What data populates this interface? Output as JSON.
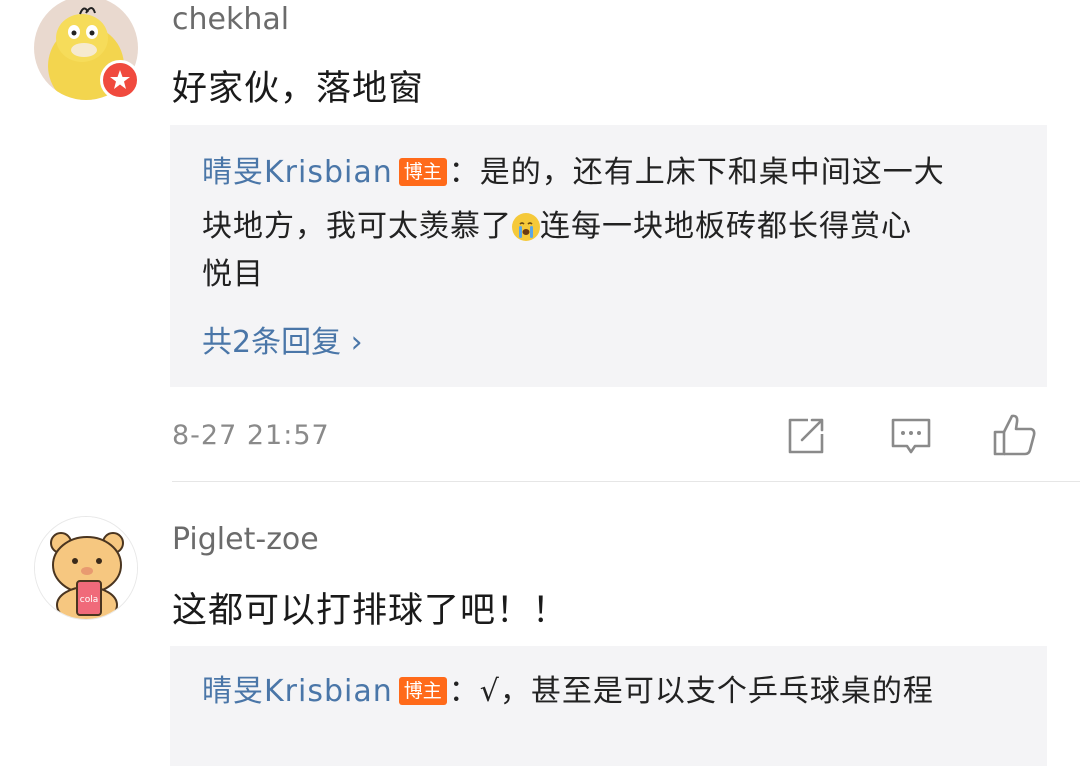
{
  "comments": [
    {
      "username": "chekhal",
      "text": "好家伙，落地窗",
      "reply": {
        "replier": "晴旻Krisbian",
        "badge": "博主",
        "line1": "：是的，还有上床下和桌中间这一大",
        "line2a": "块地方，我可太羡慕了",
        "line2b": "连每一块地板砖都长得赏心",
        "line3": "悦目"
      },
      "total_replies": "共2条回复 ›",
      "timestamp": "8-27 21:57"
    },
    {
      "username": "Piglet-zoe",
      "text": "这都可以打排球了吧！！",
      "reply": {
        "replier": "晴旻Krisbian",
        "badge": "博主",
        "line1": "：√，甚至是可以支个乒乓球桌的程"
      },
      "avatar_cup_text": "cola"
    }
  ],
  "icons": {
    "share": "share-icon",
    "comment": "comment-icon",
    "like": "thumbs-up-icon",
    "verified": "verified-badge-icon",
    "emoji": "crying-emoji-icon"
  },
  "colors": {
    "link_blue": "#4a76a8",
    "host_badge": "#ff6a1a",
    "verified_red": "#f04a3e",
    "reply_bg": "#f4f4f6"
  }
}
